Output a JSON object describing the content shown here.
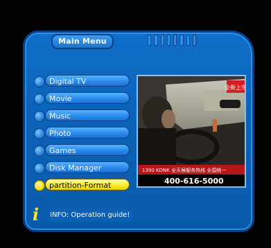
{
  "header": {
    "title": "Main Menu"
  },
  "menu": {
    "items": [
      {
        "label": "Digital TV"
      },
      {
        "label": "Movie"
      },
      {
        "label": "Music"
      },
      {
        "label": "Photo"
      },
      {
        "label": "Games"
      },
      {
        "label": "Disk Manager"
      },
      {
        "label": "partition-Format"
      }
    ],
    "selected_index": 6
  },
  "preview": {
    "overlay_top": "全新上市",
    "ticker": "1390 KDNK 全天候服务热线 全国统一",
    "phone": "400-616-5000"
  },
  "info": {
    "icon": "info-icon",
    "text": "INFO: Operation guide!"
  },
  "colors": {
    "panel": "#0c63b9",
    "highlight": "#ffee2a",
    "item": "#2a8bea"
  }
}
